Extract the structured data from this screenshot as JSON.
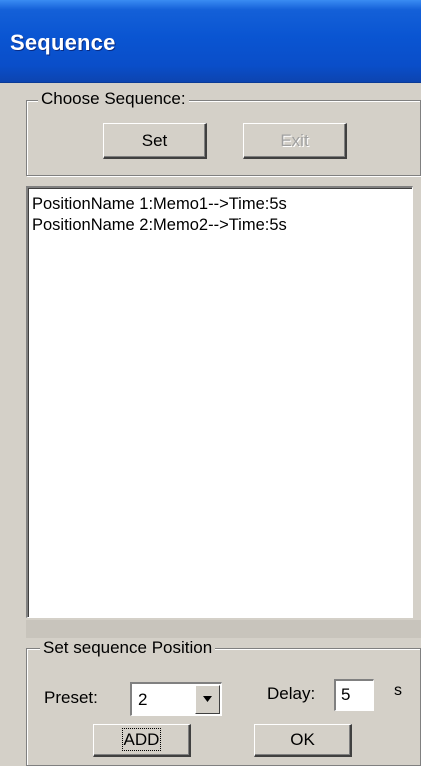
{
  "window": {
    "title": "Sequence"
  },
  "choose_group": {
    "label": "Choose Sequence:",
    "set_label": "Set",
    "exit_label": "Exit"
  },
  "sequence_list": {
    "items": [
      "PositionName 1:Memo1-->Time:5s",
      "PositionName 2:Memo2-->Time:5s"
    ]
  },
  "position_group": {
    "label": "Set sequence Position",
    "preset_label": "Preset:",
    "preset_value": "2",
    "delay_label": "Delay:",
    "delay_value": "5",
    "delay_unit": "s",
    "add_label": "ADD",
    "ok_label": "OK"
  },
  "colors": {
    "titlebar": "#0a55d2",
    "face": "#d4d0c8"
  }
}
